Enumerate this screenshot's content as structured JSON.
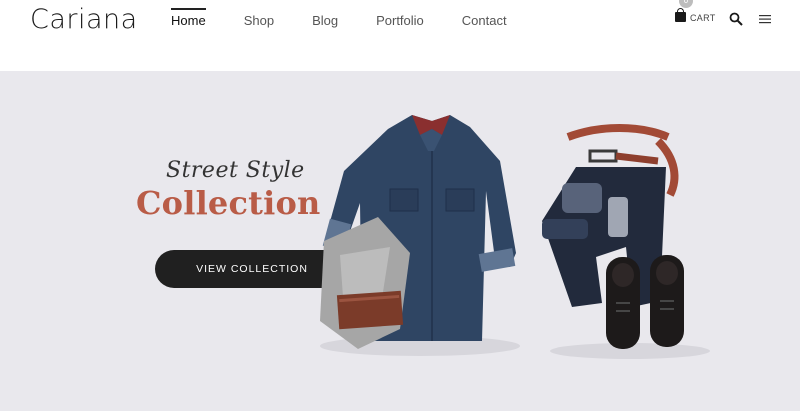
{
  "brand": {
    "logo_text": "Cariana"
  },
  "nav": {
    "items": [
      {
        "label": "Home",
        "active": true
      },
      {
        "label": "Shop",
        "active": false
      },
      {
        "label": "Blog",
        "active": false
      },
      {
        "label": "Portfolio",
        "active": false
      },
      {
        "label": "Contact",
        "active": false
      }
    ]
  },
  "header_actions": {
    "cart_label": "CART",
    "cart_count": "0",
    "search_icon": "search-icon",
    "menu_icon": "hamburger-menu-icon"
  },
  "hero": {
    "subtitle": "Street Style",
    "title": "Collection",
    "button_label": "VIEW COLLECTION",
    "background_color": "#e9e8ed",
    "title_color": "#b95c47",
    "button_color": "#202020"
  }
}
